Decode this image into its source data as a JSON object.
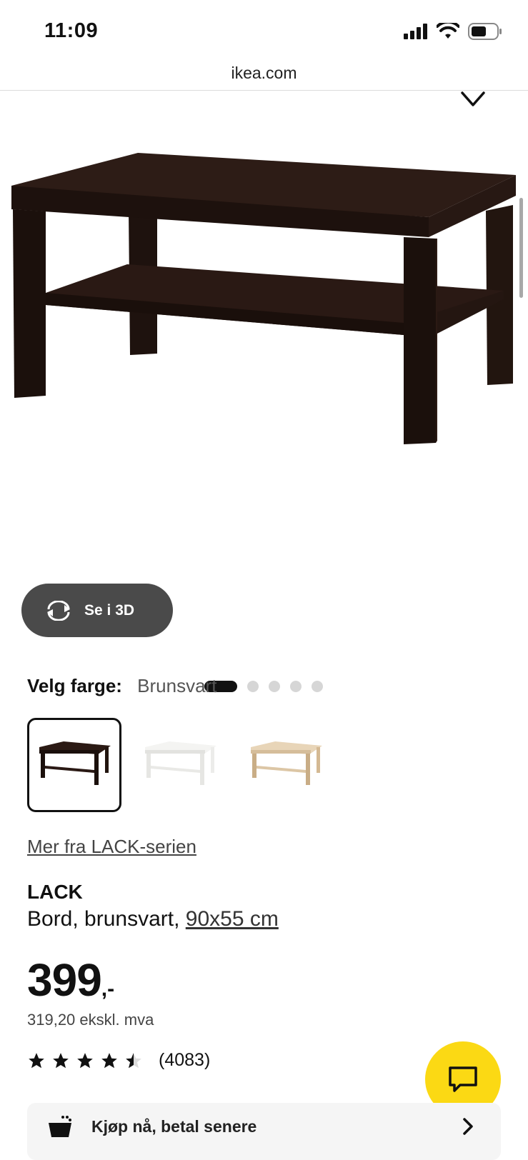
{
  "status_bar": {
    "time": "11:09"
  },
  "browser": {
    "url": "ikea.com"
  },
  "gallery": {
    "view_3d_label": "Se i 3D",
    "total_images": 5,
    "active_index": 0
  },
  "color_select": {
    "label": "Velg farge:",
    "value": "Brunsvart",
    "options": [
      "brunsvart",
      "hvit",
      "hvitbeiset eikemønstret"
    ]
  },
  "series_link": "Mer fra LACK-serien",
  "product": {
    "name": "LACK",
    "description": "Bord, brunsvart, ",
    "dimension_link": "90x55 cm",
    "price": "399",
    "price_suffix": ",-",
    "price_ex_vat": "319,20 ekskl. mva",
    "rating": 4.5,
    "rating_count": "(4083)"
  },
  "financing": {
    "label": "Kjøp nå, betal senere"
  },
  "colors": {
    "accent": "#fbd914",
    "button_dark": "#4a4a4a",
    "table_dark": "#2b1a14"
  }
}
